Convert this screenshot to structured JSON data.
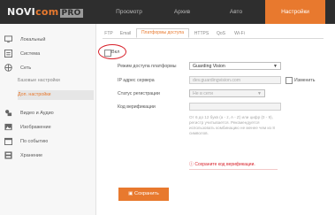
{
  "header": {
    "logo_part1": "NOVI",
    "logo_part2": "com",
    "logo_part3": "PRO",
    "tabs": [
      {
        "label": "Просмотр"
      },
      {
        "label": "Архив"
      },
      {
        "label": "Авто"
      },
      {
        "label": "Настройки"
      }
    ],
    "active_color": "#e8792e"
  },
  "sidebar": {
    "items": [
      {
        "label": "Локальный",
        "icon": "monitor-icon"
      },
      {
        "label": "Система",
        "icon": "system-icon"
      },
      {
        "label": "Сеть",
        "icon": "network-icon"
      },
      {
        "label": "Видео и Аудио",
        "icon": "video-icon"
      },
      {
        "label": "Изображение",
        "icon": "image-icon"
      },
      {
        "label": "По событию",
        "icon": "event-icon"
      },
      {
        "label": "Хранение",
        "icon": "storage-icon"
      }
    ],
    "sub_items": [
      {
        "label": "Базовые настройки"
      },
      {
        "label": "Доп. настройки"
      }
    ]
  },
  "subtabs": [
    "FTP",
    "Email",
    "Платформы доступа",
    "HTTPS",
    "QoS",
    "Wi-Fi"
  ],
  "form": {
    "enable_label": "Вкл",
    "platform_label": "Режим доступа платформы",
    "platform_value": "Guarding Vision",
    "server_label": "IP адрес сервера",
    "server_value": "dev.guardingvision.com",
    "change_label": "Изменить",
    "status_label": "Статус регистрации",
    "status_value": "Не в сети",
    "code_label": "Код верификации",
    "hint": "От 6 до 12 букв (a - z, A - Z) или цифр (0 - 9), регистр учитывается. Рекомендуется использовать комбинацию не менее чем из 8 символов.",
    "warning": "Сохраните код верификации.",
    "save_label": "Сохранить"
  }
}
